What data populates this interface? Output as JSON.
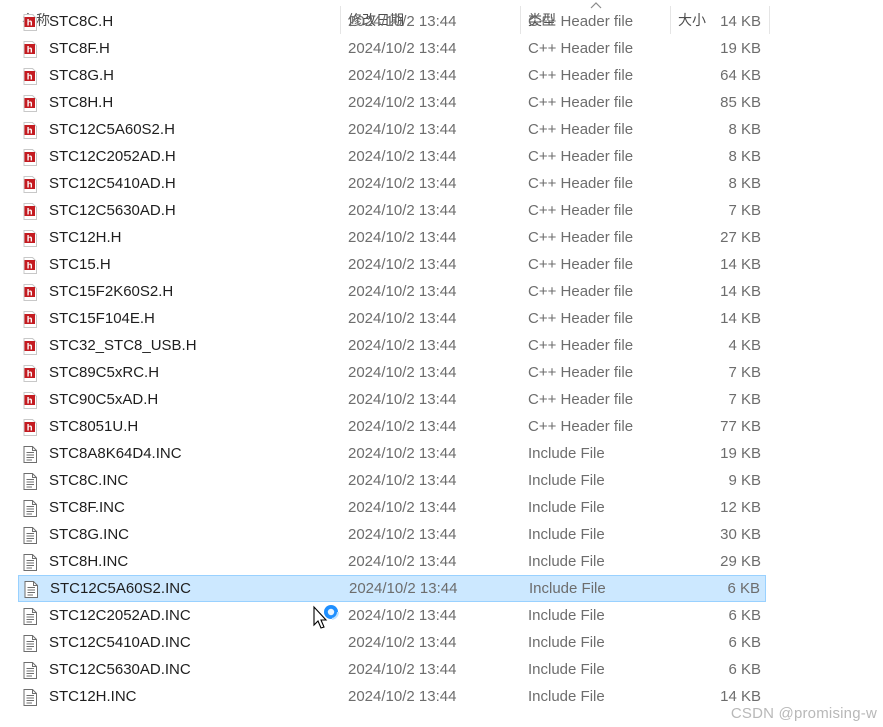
{
  "header": {
    "name_label": "名称",
    "date_label": "修改日期",
    "type_label": "类型",
    "size_label": "大小"
  },
  "files": [
    {
      "name": "STC8C.H",
      "date": "2024/10/2 13:44",
      "type": "C++ Header file",
      "size": "14 KB",
      "icon": "h-file-icon"
    },
    {
      "name": "STC8F.H",
      "date": "2024/10/2 13:44",
      "type": "C++ Header file",
      "size": "19 KB",
      "icon": "h-file-icon"
    },
    {
      "name": "STC8G.H",
      "date": "2024/10/2 13:44",
      "type": "C++ Header file",
      "size": "64 KB",
      "icon": "h-file-icon"
    },
    {
      "name": "STC8H.H",
      "date": "2024/10/2 13:44",
      "type": "C++ Header file",
      "size": "85 KB",
      "icon": "h-file-icon"
    },
    {
      "name": "STC12C5A60S2.H",
      "date": "2024/10/2 13:44",
      "type": "C++ Header file",
      "size": "8 KB",
      "icon": "h-file-icon"
    },
    {
      "name": "STC12C2052AD.H",
      "date": "2024/10/2 13:44",
      "type": "C++ Header file",
      "size": "8 KB",
      "icon": "h-file-icon"
    },
    {
      "name": "STC12C5410AD.H",
      "date": "2024/10/2 13:44",
      "type": "C++ Header file",
      "size": "8 KB",
      "icon": "h-file-icon"
    },
    {
      "name": "STC12C5630AD.H",
      "date": "2024/10/2 13:44",
      "type": "C++ Header file",
      "size": "7 KB",
      "icon": "h-file-icon"
    },
    {
      "name": "STC12H.H",
      "date": "2024/10/2 13:44",
      "type": "C++ Header file",
      "size": "27 KB",
      "icon": "h-file-icon"
    },
    {
      "name": "STC15.H",
      "date": "2024/10/2 13:44",
      "type": "C++ Header file",
      "size": "14 KB",
      "icon": "h-file-icon"
    },
    {
      "name": "STC15F2K60S2.H",
      "date": "2024/10/2 13:44",
      "type": "C++ Header file",
      "size": "14 KB",
      "icon": "h-file-icon"
    },
    {
      "name": "STC15F104E.H",
      "date": "2024/10/2 13:44",
      "type": "C++ Header file",
      "size": "14 KB",
      "icon": "h-file-icon"
    },
    {
      "name": "STC32_STC8_USB.H",
      "date": "2024/10/2 13:44",
      "type": "C++ Header file",
      "size": "4 KB",
      "icon": "h-file-icon"
    },
    {
      "name": "STC89C5xRC.H",
      "date": "2024/10/2 13:44",
      "type": "C++ Header file",
      "size": "7 KB",
      "icon": "h-file-icon"
    },
    {
      "name": "STC90C5xAD.H",
      "date": "2024/10/2 13:44",
      "type": "C++ Header file",
      "size": "7 KB",
      "icon": "h-file-icon"
    },
    {
      "name": "STC8051U.H",
      "date": "2024/10/2 13:44",
      "type": "C++ Header file",
      "size": "77 KB",
      "icon": "h-file-icon"
    },
    {
      "name": "STC8A8K64D4.INC",
      "date": "2024/10/2 13:44",
      "type": "Include File",
      "size": "19 KB",
      "icon": "text-file-icon"
    },
    {
      "name": "STC8C.INC",
      "date": "2024/10/2 13:44",
      "type": "Include File",
      "size": "9 KB",
      "icon": "text-file-icon"
    },
    {
      "name": "STC8F.INC",
      "date": "2024/10/2 13:44",
      "type": "Include File",
      "size": "12 KB",
      "icon": "text-file-icon"
    },
    {
      "name": "STC8G.INC",
      "date": "2024/10/2 13:44",
      "type": "Include File",
      "size": "30 KB",
      "icon": "text-file-icon"
    },
    {
      "name": "STC8H.INC",
      "date": "2024/10/2 13:44",
      "type": "Include File",
      "size": "29 KB",
      "icon": "text-file-icon"
    },
    {
      "name": "STC12C5A60S2.INC",
      "date": "2024/10/2 13:44",
      "type": "Include File",
      "size": "6 KB",
      "icon": "text-file-icon",
      "selected": true
    },
    {
      "name": "STC12C2052AD.INC",
      "date": "2024/10/2 13:44",
      "type": "Include File",
      "size": "6 KB",
      "icon": "text-file-icon"
    },
    {
      "name": "STC12C5410AD.INC",
      "date": "2024/10/2 13:44",
      "type": "Include File",
      "size": "6 KB",
      "icon": "text-file-icon"
    },
    {
      "name": "STC12C5630AD.INC",
      "date": "2024/10/2 13:44",
      "type": "Include File",
      "size": "6 KB",
      "icon": "text-file-icon"
    },
    {
      "name": "STC12H.INC",
      "date": "2024/10/2 13:44",
      "type": "Include File",
      "size": "14 KB",
      "icon": "text-file-icon"
    }
  ],
  "cursor": {
    "icon": "busy-pointer-icon"
  },
  "watermark": "CSDN @promising-w",
  "colors": {
    "selection_bg": "#cce8ff",
    "selection_border": "#99d1ff",
    "h_icon_red": "#c41b21"
  }
}
